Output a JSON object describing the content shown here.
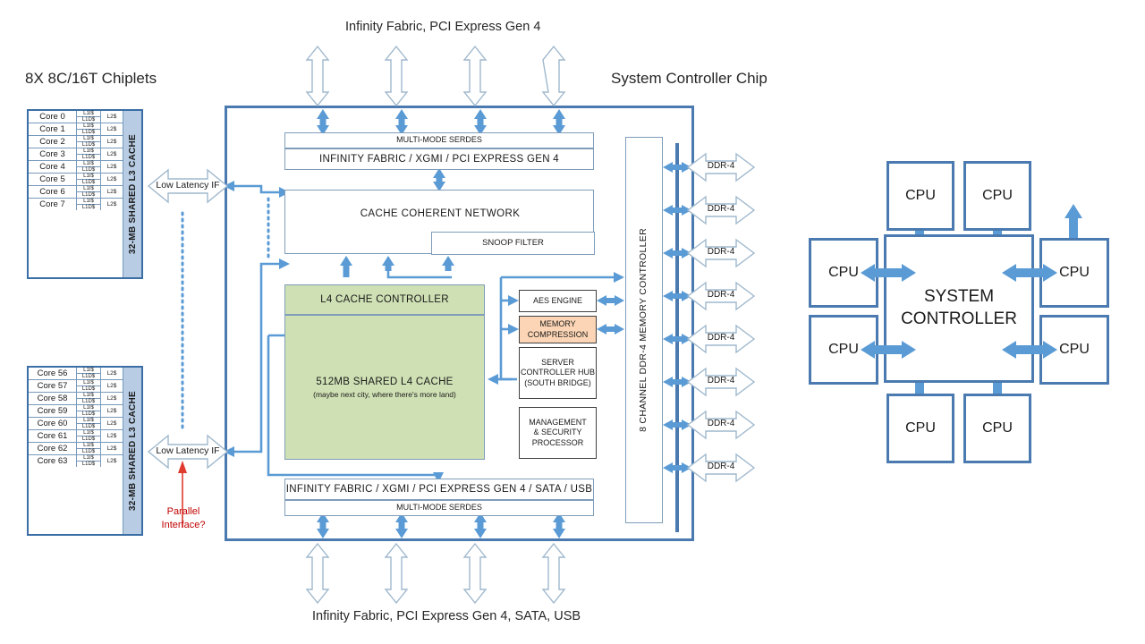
{
  "headings": {
    "chiplets": "8X 8C/16T Chiplets",
    "system_controller_chip": "System Controller Chip",
    "top_caption": "Infinity Fabric, PCI Express Gen 4",
    "bottom_caption": "Infinity Fabric, PCI Express Gen 4, SATA, USB"
  },
  "chiplet_top": {
    "l3_label": "32-MB SHARED  L3 CACHE",
    "l1i": "L1I$",
    "l1d": "L1D$",
    "l2": "L2$",
    "cores": [
      "Core 0",
      "Core 1",
      "Core 2",
      "Core 3",
      "Core 4",
      "Core 5",
      "Core 6",
      "Core 7"
    ]
  },
  "chiplet_bottom": {
    "l3_label": "32-MB SHARED  L3 CACHE",
    "l1i": "L1I$",
    "l1d": "L1D$",
    "l2": "L2$",
    "cores": [
      "Core 56",
      "Core 57",
      "Core 58",
      "Core 59",
      "Core 60",
      "Core 61",
      "Core 62",
      "Core 63"
    ]
  },
  "interconnect": {
    "low_latency_top": "Low Latency IF",
    "low_latency_bottom": "Low Latency IF",
    "parallel_note_line1": "Parallel",
    "parallel_note_line2": "Interface?"
  },
  "chip": {
    "top_serdes": "MULTI-MODE SERDES",
    "top_fabric": "INFINITY FABRIC / XGMI / PCI EXPRESS GEN  4",
    "cache_network": "CACHE  COHERENT  NETWORK",
    "snoop_filter": "SNOOP FILTER",
    "l4_controller": "L4 CACHE  CONTROLLER",
    "l4_cache_title": "512MB SHARED  L4 CACHE",
    "l4_cache_sub": "(maybe next city, where there's more land)",
    "aes_engine": "AES ENGINE",
    "memory_compression_line1": "MEMORY",
    "memory_compression_line2": "COMPRESSION",
    "south_bridge_line1": "SERVER",
    "south_bridge_line2": "CONTROLLER HUB",
    "south_bridge_line3": "(SOUTH BRIDGE)",
    "mgmt_line1": "MANAGEMENT",
    "mgmt_line2": "& SECURITY",
    "mgmt_line3": "PROCESSOR",
    "memory_controller": "8 CHANNEL  DDR-4  MEMORY CONTROLLER",
    "bottom_fabric": "INFINITY FABRIC / XGMI / PCI EXPRESS GEN  4 / SATA / USB",
    "bottom_serdes": "MULTI-MODE SERDES"
  },
  "memory": {
    "channels": [
      "DDR-4",
      "DDR-4",
      "DDR-4",
      "DDR-4",
      "DDR-4",
      "DDR-4",
      "DDR-4",
      "DDR-4"
    ]
  },
  "topology": {
    "system_controller_line1": "SYSTEM",
    "system_controller_line2": "CONTROLLER",
    "cpus": [
      "CPU",
      "CPU",
      "CPU",
      "CPU",
      "CPU",
      "CPU",
      "CPU",
      "CPU"
    ]
  },
  "colors": {
    "chip_border": "#4a7ab0",
    "accent_blue": "#5b9bd5",
    "l3_fill": "#b8cce4",
    "l4_fill": "#cfe0b4",
    "compression_fill": "#fbd5b5",
    "red_annotation": "#c00000"
  }
}
